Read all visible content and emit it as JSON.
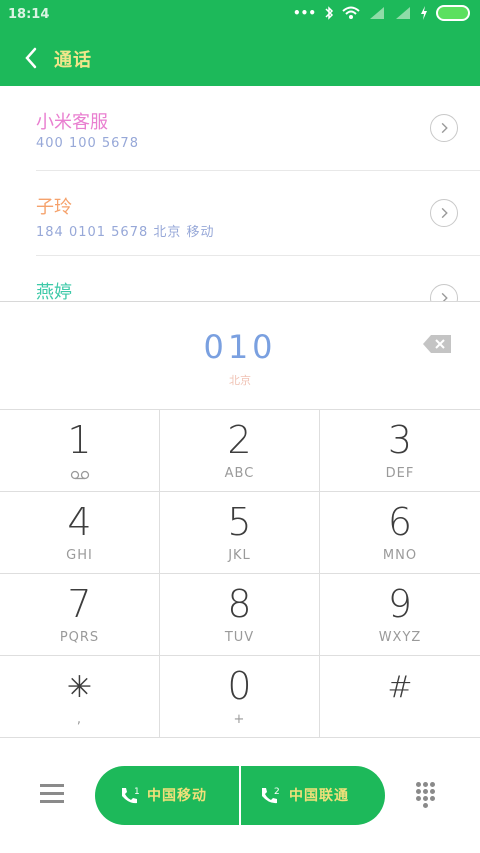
{
  "status_bar": {
    "time": "18:14",
    "more": "•••"
  },
  "app_bar": {
    "title": "通话"
  },
  "contacts": [
    {
      "name": "小米客服",
      "detail": "400 100 5678",
      "name_color": "#e97fd0"
    },
    {
      "name": "子玲",
      "detail": "184 0101 5678  北京 移动",
      "name_color": "#f5a26c"
    },
    {
      "name": "燕婷",
      "detail": "",
      "name_color": "#3dc9a8"
    }
  ],
  "dial_input": {
    "number": "010",
    "location": "北京"
  },
  "keypad": [
    {
      "digit": "1",
      "letters": ""
    },
    {
      "digit": "2",
      "letters": "ABC"
    },
    {
      "digit": "3",
      "letters": "DEF"
    },
    {
      "digit": "4",
      "letters": "GHI"
    },
    {
      "digit": "5",
      "letters": "JKL"
    },
    {
      "digit": "6",
      "letters": "MNO"
    },
    {
      "digit": "7",
      "letters": "PQRS"
    },
    {
      "digit": "8",
      "letters": "TUV"
    },
    {
      "digit": "9",
      "letters": "WXYZ"
    },
    {
      "digit": "✳",
      "letters": ","
    },
    {
      "digit": "0",
      "letters": "+"
    },
    {
      "digit": "#",
      "letters": ""
    }
  ],
  "call_buttons": [
    {
      "sim": "1",
      "carrier": "中国移动"
    },
    {
      "sim": "2",
      "carrier": "中国联通"
    }
  ],
  "colors": {
    "accent": "#1db95a"
  }
}
